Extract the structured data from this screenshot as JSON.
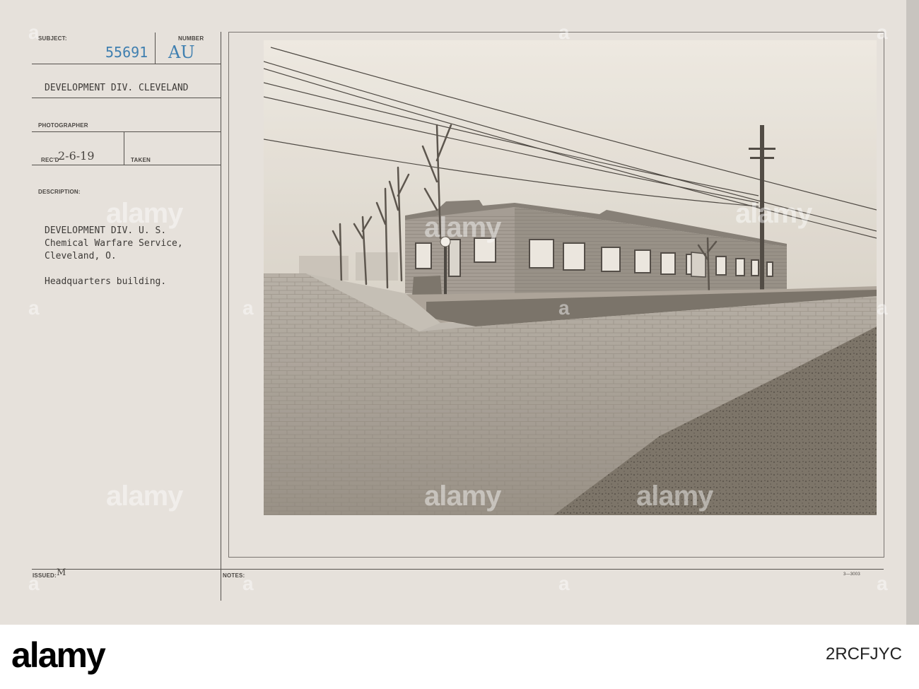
{
  "card": {
    "subject_label": "SUBJECT:",
    "number_label": "NUMBER",
    "number_value": "55691",
    "number_suffix": "AU",
    "division": "DEVELOPMENT DIV. CLEVELAND",
    "photographer_label": "PHOTOGRAPHER",
    "recd_label": "REC'D",
    "recd_value": "2-6-19",
    "taken_label": "TAKEN",
    "description_label": "DESCRIPTION:",
    "description_lines": [
      "DEVELOPMENT DIV. U. S.",
      "Chemical Warfare Service,",
      "Cleveland, O."
    ],
    "caption": "Headquarters building.",
    "issued_label": "ISSUED:",
    "issued_mark": "M",
    "notes_label": "NOTES:",
    "form_code": "3—3003"
  },
  "watermark": {
    "text": "alamy",
    "footer_logo": "alamy",
    "image_id": "2RCFJYC",
    "credit": "a"
  },
  "colors": {
    "card_bg": "#e6e1db",
    "stamp_blue": "#3f7fb0",
    "ink": "#3d3a37"
  }
}
